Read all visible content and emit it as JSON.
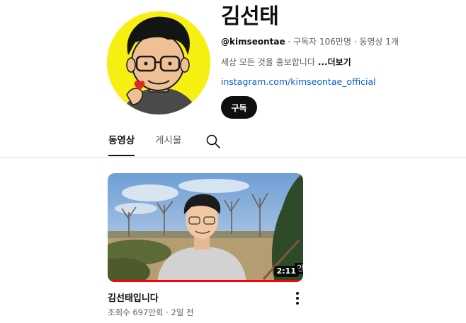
{
  "channel": {
    "name": "김선태",
    "handle": "@kimseontae",
    "separator": " · ",
    "subscribers": "구독자 106만명",
    "video_count": "동영상 1개",
    "description": "세상 모든 것을 홍보합니다",
    "more_label": "...더보기",
    "link": "instagram.com/kimseontae_official",
    "subscribe_label": "구독"
  },
  "tabs": [
    {
      "label": "동영상",
      "active": true
    },
    {
      "label": "게시물",
      "active": false
    }
  ],
  "video": {
    "title": "김선태입니다",
    "stats": "조회수 697만회 · 2일 전",
    "duration": "2:11",
    "caption": "안녕하세요"
  },
  "colors": {
    "accent": "#ff0000",
    "link": "#065fd4",
    "avatar_bg": "#f7ef12"
  },
  "icons": {
    "search_tab": "search-icon",
    "video_menu": "more-vert-icon"
  }
}
